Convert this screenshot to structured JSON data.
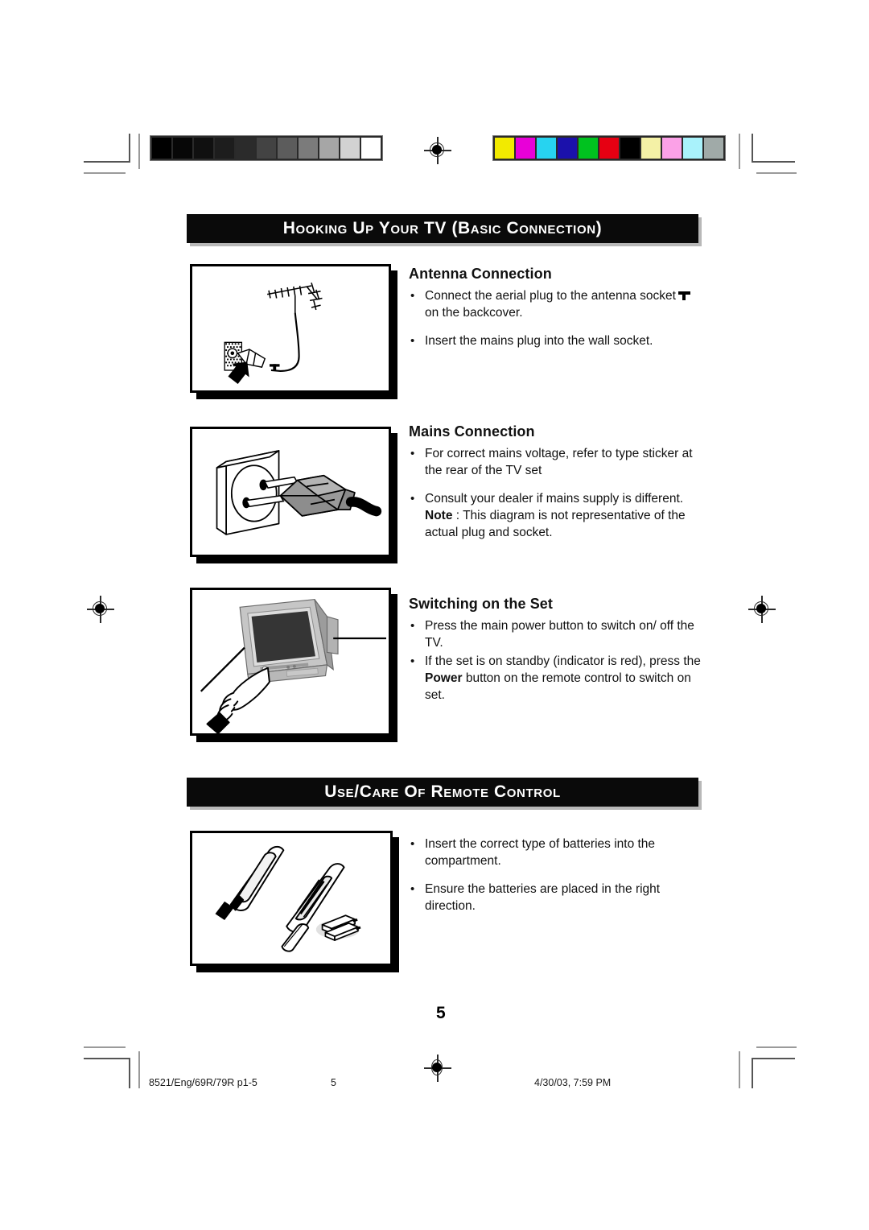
{
  "document": {
    "page_number": "5"
  },
  "sections": [
    {
      "id": "hooking-up",
      "title": "Hooking up Your TV (Basic Connection)"
    },
    {
      "id": "use-care",
      "title": "Use/Care of Remote Control"
    }
  ],
  "topics": {
    "antenna": {
      "heading": "Antenna Connection",
      "bullets": [
        {
          "text_before": "Connect the aerial plug to the antenna socket",
          "symbol": "antenna-socket-icon",
          "text_after": "on the backcover."
        },
        {
          "text_before": "Insert the mains plug into the wall socket.",
          "symbol": "",
          "text_after": ""
        }
      ],
      "figure_caption": "antenna-connection-illustration"
    },
    "mains": {
      "heading": "Mains Connection",
      "bullets": [
        {
          "text": "For correct mains voltage, refer to type sticker at the rear of the TV set"
        },
        {
          "text": "Consult your dealer if mains supply is different.",
          "note_label": "Note",
          "note_text": " : This diagram is not representative of the actual plug and socket."
        }
      ],
      "figure_caption": "mains-plug-socket-illustration"
    },
    "switching": {
      "heading": "Switching on the Set",
      "bullets": [
        {
          "text": "Press the main power button to switch on/ off the TV."
        },
        {
          "text_before": "If the set is on standby (indicator is red), press the",
          "bold": "Power",
          "text_after": "button on the remote control to switch on set."
        }
      ],
      "figure_caption": "tv-power-button-illustration"
    },
    "remote": {
      "bullets": [
        {
          "text": "Insert the correct type of batteries into the compartment."
        },
        {
          "text": "Ensure the batteries are placed in the right direction."
        }
      ],
      "figure_caption": "remote-control-battery-illustration"
    }
  },
  "footer": {
    "job_ref": "8521/Eng/69R/79R p1-5",
    "page": "5",
    "timestamp": "4/30/03, 7:59 PM"
  },
  "print_marks": {
    "grayscale_patches": [
      "#000000",
      "#070707",
      "#101010",
      "#1d1d1d",
      "#2b2b2b",
      "#434343",
      "#5c5c5c",
      "#7b7b7b",
      "#a6a6a6",
      "#d2d2d2",
      "#ffffff"
    ],
    "color_patches": [
      "#f2ea00",
      "#e800d8",
      "#27d3f0",
      "#1b11ab",
      "#00c21f",
      "#e60012",
      "#000000",
      "#f4f1a6",
      "#fba1e7",
      "#a9f2fb",
      "#a0aaa8"
    ]
  }
}
